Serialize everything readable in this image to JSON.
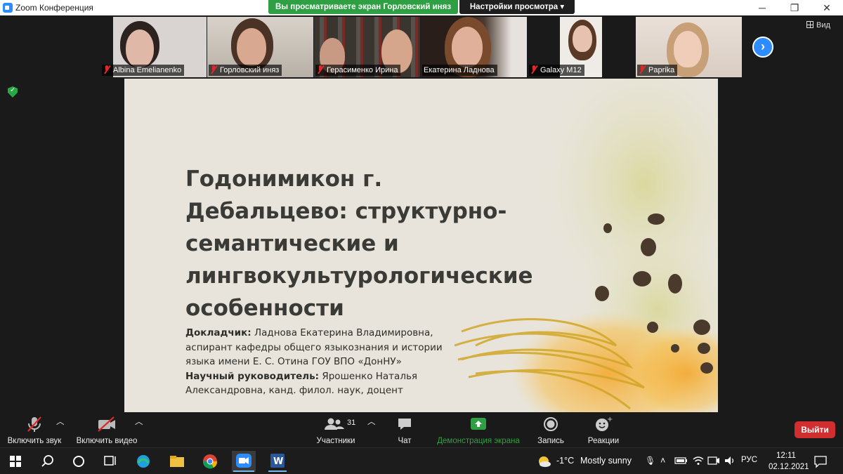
{
  "window": {
    "title": "Zoom Конференция",
    "share_banner": "Вы просматриваете экран Горловский иняз",
    "view_options": "Настройки просмотра",
    "view_label": "Вид",
    "minimize": "─",
    "maximize": "❐",
    "close": "✕"
  },
  "participants": [
    {
      "name": "Albina Emelianenko",
      "muted": true
    },
    {
      "name": "Горловский иняз",
      "muted": true
    },
    {
      "name": "Герасименко Ирина",
      "muted": true
    },
    {
      "name": "Екатерина Ладнова",
      "muted": false,
      "active": true
    },
    {
      "name": "Galaxy M12",
      "muted": true
    },
    {
      "name": "Paprika",
      "muted": true
    }
  ],
  "slide": {
    "title": "Годонимикон г. Дебальцево: структурно-семантические и лингвокультурологические особенности",
    "speaker_label": "Докладчик:",
    "speaker_text": " Ладнова Екатерина Владимировна, аспирант кафедры общего языкознания и истории языка имени Е. С. Отина ГОУ ВПО «ДонНУ»",
    "advisor_label": "Научный руководитель:",
    "advisor_text": " Ярошенко Наталья Александровна, канд. филол. наук, доцент"
  },
  "controls": {
    "unmute": "Включить звук",
    "start_video": "Включить видео",
    "participants": "Участники",
    "participants_count": "31",
    "chat": "Чат",
    "share_screen": "Демонстрация экрана",
    "record": "Запись",
    "reactions": "Реакции",
    "leave": "Выйти"
  },
  "taskbar": {
    "weather_temp": "-1°C",
    "weather_desc": "Mostly sunny",
    "language": "РУС",
    "time": "12:11",
    "date": "02.12.2021"
  },
  "colors": {
    "share_green": "#2ea043",
    "zoom_blue": "#2d8cff",
    "leave_red": "#d12f2f",
    "active_speaker": "#a5d640"
  }
}
